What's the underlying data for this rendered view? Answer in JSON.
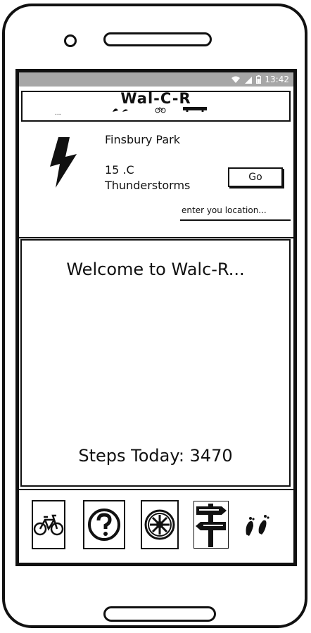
{
  "status": {
    "wifi_icon": "wifi-icon",
    "signal_icon": "signal-icon",
    "battery_icon": "battery-icon",
    "time": "13:42"
  },
  "header": {
    "app_title": "Wal-C-R",
    "menu_dots": "..."
  },
  "weather": {
    "location": "Finsbury Park",
    "temperature": "15 .C",
    "condition": "Thunderstorms",
    "icon": "lightning-icon"
  },
  "search": {
    "go_label": "Go",
    "placeholder": "enter you location..."
  },
  "main": {
    "welcome": "Welcome to Walc-R...",
    "steps_label": "Steps Today: 3470"
  },
  "nav": {
    "items": [
      {
        "icon": "bicycle-icon"
      },
      {
        "icon": "help-icon"
      },
      {
        "icon": "settings-wheel-icon"
      },
      {
        "icon": "signpost-icon"
      },
      {
        "icon": "footprints-icon"
      }
    ]
  }
}
